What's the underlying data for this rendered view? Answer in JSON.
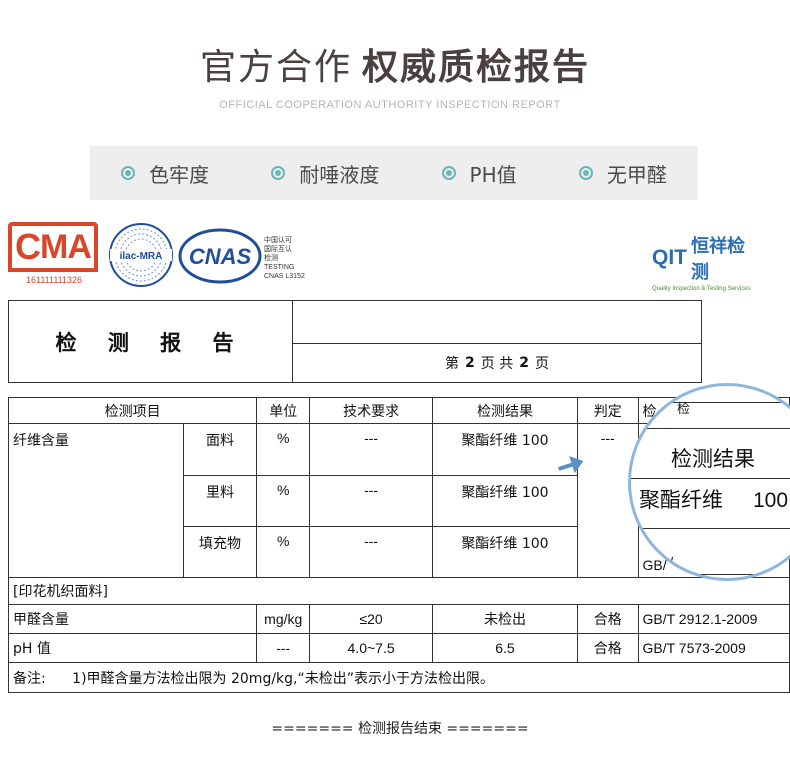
{
  "header": {
    "title_light": "官方合作",
    "title_bold": "权威质检报告",
    "subtitle": "OFFICIAL COOPERATION AUTHORITY INSPECTION REPORT"
  },
  "features": [
    "色牢度",
    "耐唾液度",
    "PH值",
    "无甲醛"
  ],
  "logos": {
    "cma_text": "MA",
    "cma_number": "161111111326",
    "ilac_text": "ilac-MRA",
    "cnas_text": "CNAS",
    "cnas_lines": [
      "中国认可",
      "国际互认",
      "检测",
      "TESTING",
      "CNAS L3152"
    ],
    "qit_text": "QIT",
    "qit_cn": "恒祥检测",
    "qit_sub": "Quality Inspection & Testing Services"
  },
  "report": {
    "title": "检 测 报 告",
    "page_prefix": "第",
    "page_num": "2",
    "page_mid": "页 共",
    "page_total": "2",
    "page_suffix": "页"
  },
  "table": {
    "headers": [
      "检测项目",
      "单位",
      "技术要求",
      "检测结果",
      "判定",
      "检"
    ],
    "fiber": {
      "item": "纤维含量",
      "judge": "---",
      "rows": [
        {
          "part": "面料",
          "unit": "%",
          "req": "---",
          "result": "聚酯纤维 100"
        },
        {
          "part": "里料",
          "unit": "%",
          "req": "---",
          "result": "聚酯纤维 100"
        },
        {
          "part": "填充物",
          "unit": "%",
          "req": "---",
          "result": "聚酯纤维 100"
        }
      ],
      "method_fragment": "GB/"
    },
    "section_label": "[印花机织面料]",
    "rows": [
      {
        "item": "甲醛含量",
        "unit": "mg/kg",
        "req": "≤20",
        "result": "未检出",
        "judge": "合格",
        "method": "GB/T 2912.1-2009"
      },
      {
        "item": "pH 值",
        "unit": "---",
        "req": "4.0~7.5",
        "result": "6.5",
        "judge": "合格",
        "method": "GB/T 7573-2009"
      }
    ],
    "note_label": "备注:",
    "note_text": "1)甲醛含量方法检出限为 20mg/kg,“未检出”表示小于方法检出限。"
  },
  "magnifier": {
    "header": "检测结果",
    "value_label": "聚酯纤维",
    "value_num": "100",
    "gb_fragment": "GB/"
  },
  "footer": {
    "end_text": "======= 检测报告结束 ======="
  },
  "colors": {
    "accent_teal": "#6bb5b7",
    "cma_red": "#d9462a",
    "cnas_blue": "#1f4e9a",
    "magnifier_border": "#8fb6dc",
    "arrow_blue": "#5b8fc8"
  }
}
